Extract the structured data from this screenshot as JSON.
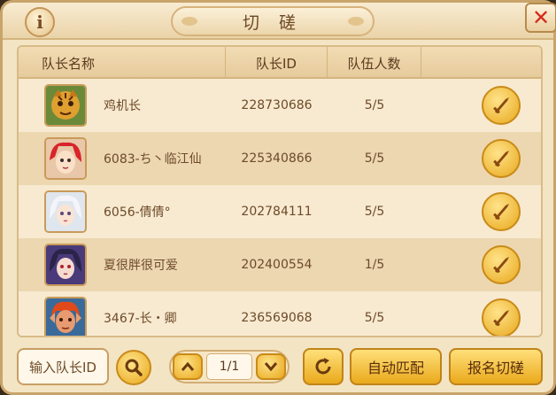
{
  "title": "切 磋",
  "info_icon": "i",
  "close_icon": "✕",
  "table": {
    "headers": [
      "队长名称",
      "队长ID",
      "队伍人数"
    ],
    "rows": [
      {
        "name": "鸡机长",
        "id": "228730686",
        "count": "5/5",
        "avatar": "tiger-warrior-avatar"
      },
      {
        "name": "6083-ち丶临江仙",
        "id": "225340866",
        "count": "5/5",
        "avatar": "red-hair-girl-avatar"
      },
      {
        "name": "6056-倩倩°",
        "id": "202784111",
        "count": "5/5",
        "avatar": "white-hair-girl-avatar"
      },
      {
        "name": "夏很胖很可爱",
        "id": "202400554",
        "count": "1/5",
        "avatar": "dark-hair-girl-avatar"
      },
      {
        "name": "3467-长・卿",
        "id": "236569068",
        "count": "5/5",
        "avatar": "red-demon-avatar"
      }
    ]
  },
  "bottom": {
    "search_placeholder": "输入队长ID",
    "page": "1/1",
    "auto_match": "自动匹配",
    "signup": "报名切磋"
  },
  "colors": {
    "gold": "#e8a81c",
    "panel": "#f3e4c4",
    "close": "#d42a1a"
  }
}
